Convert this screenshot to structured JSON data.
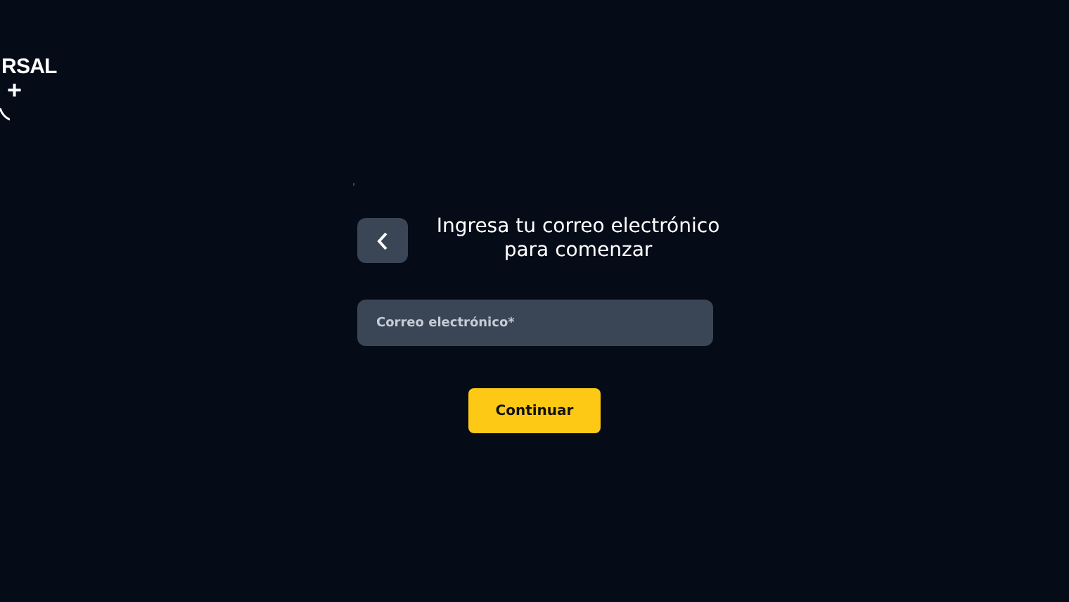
{
  "logo": {
    "wordmark": "RSAL",
    "plus": "+"
  },
  "heading": "Ingresa tu correo electrónico para comenzar",
  "email_field": {
    "placeholder": "Correo electrónico*"
  },
  "continue_button": {
    "label": "Continuar"
  }
}
